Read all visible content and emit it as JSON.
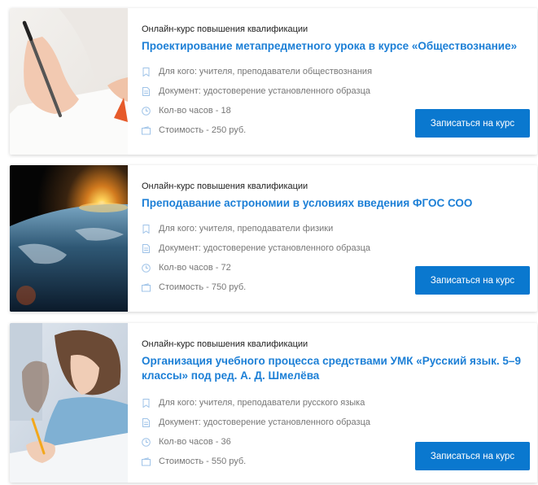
{
  "courses": [
    {
      "kind": "Онлайн-курс повышения квалификации",
      "title": "Проектирование метапредметного урока в курсе «Обществознание»",
      "audience": "Для кого: учителя, преподаватели обществознания",
      "document": "Документ: удостоверение установленного образца",
      "hours": "Кол-во часов - 18",
      "price": "Стоимость - 250 руб.",
      "button": "Записаться на курс",
      "image": "hand-writing-photo"
    },
    {
      "kind": "Онлайн-курс повышения квалификации",
      "title": "Преподавание астрономии в условиях введения ФГОС СОО",
      "audience": "Для кого: учителя, преподаватели физики",
      "document": "Документ: удостоверение установленного образца",
      "hours": "Кол-во часов - 72",
      "price": "Стоимость - 750 руб.",
      "button": "Записаться на курс",
      "image": "earth-sunrise-photo"
    },
    {
      "kind": "Онлайн-курс повышения квалификации",
      "title": "Организация учебного процесса средствами УМК «Русский язык. 5–9 классы» под ред. А. Д. Шмелёва",
      "audience": "Для кого: учителя, преподаватели русского языка",
      "document": "Документ: удостоверение установленного образца",
      "hours": "Кол-во часов - 36",
      "price": "Стоимость - 550 руб.",
      "button": "Записаться на курс",
      "image": "students-writing-photo"
    }
  ],
  "icons": {
    "audience": "bookmark-icon",
    "document": "document-icon",
    "hours": "clock-icon",
    "price": "wallet-icon"
  },
  "colors": {
    "title": "#1c7fd6",
    "button": "#0a78cf",
    "icon": "#9fc3e8"
  }
}
